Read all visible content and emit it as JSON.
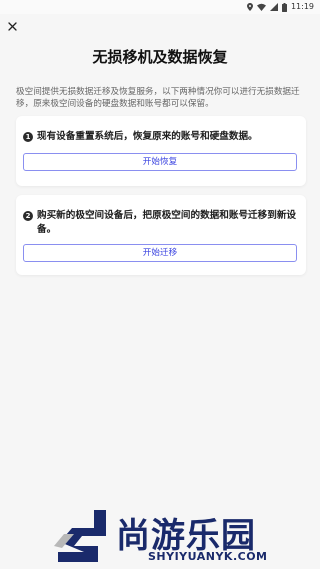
{
  "status_bar": {
    "time": "11:19"
  },
  "page": {
    "title": "无损移机及数据恢复",
    "intro": "极空间提供无损数据迁移及恢复服务，以下两种情况你可以进行无损数据迁移，原来极空间设备的硬盘数据和账号都可以保留。"
  },
  "options": [
    {
      "number": "1",
      "text": "现有设备重置系统后，恢复原来的账号和硬盘数据。",
      "button_label": "开始恢复"
    },
    {
      "number": "2",
      "text": "购买新的极空间设备后，把原极空间的数据和账号迁移到新设备。",
      "button_label": "开始迁移"
    }
  ],
  "watermark": {
    "brand": "尚游乐园",
    "domain": "SHYIYUANYK.COM"
  },
  "colors": {
    "accent": "#3a43e0",
    "button_border": "#8a8ff0",
    "background": "#f6f6f6",
    "card": "#ffffff"
  }
}
